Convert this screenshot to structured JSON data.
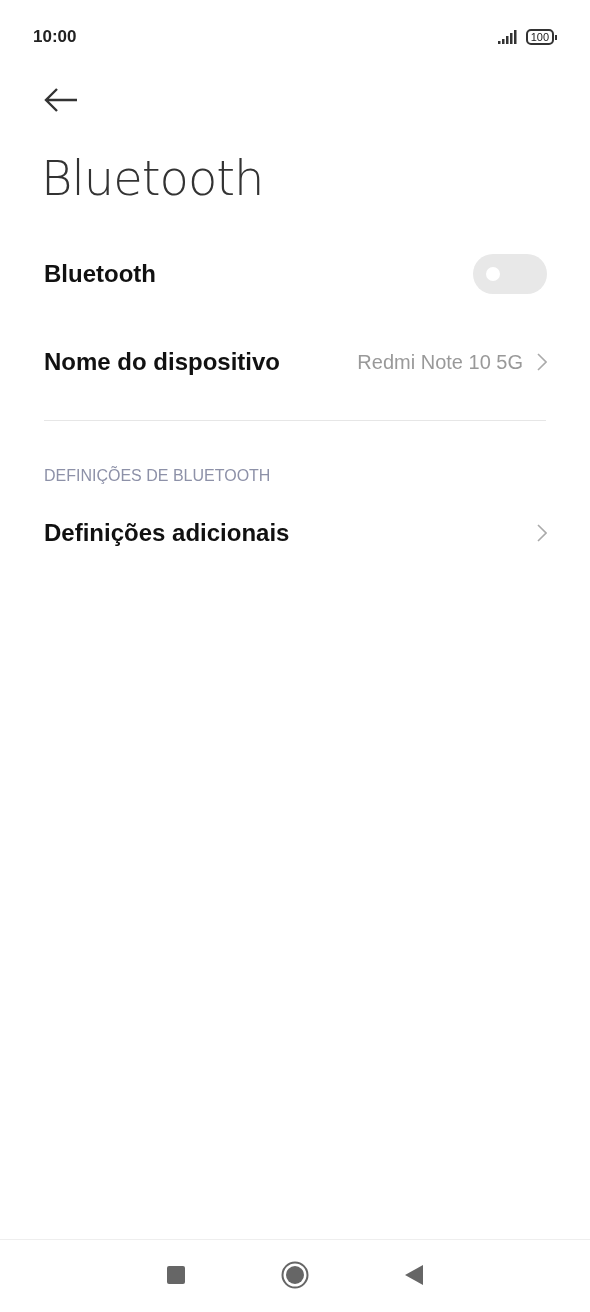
{
  "status_bar": {
    "time": "10:00",
    "battery": "100"
  },
  "title": "Bluetooth",
  "rows": [
    {
      "kind": "toggle",
      "label": "Bluetooth",
      "on": false
    },
    {
      "kind": "link",
      "label": "Nome do dispositivo",
      "value": "Redmi Note 10 5G"
    }
  ],
  "sections": [
    {
      "header": "DEFINIÇÕES DE BLUETOOTH",
      "rows": [
        {
          "kind": "link",
          "label": "Definições adicionais"
        }
      ]
    }
  ]
}
